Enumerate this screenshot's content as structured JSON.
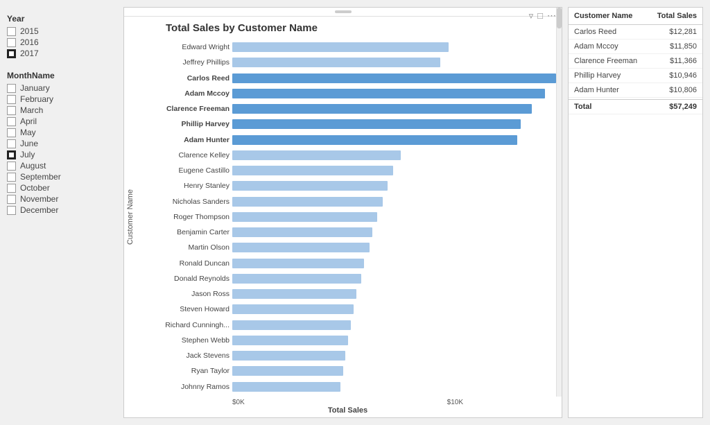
{
  "sidebar": {
    "year_label": "Year",
    "years": [
      {
        "label": "2015",
        "checked": false
      },
      {
        "label": "2016",
        "checked": false
      },
      {
        "label": "2017",
        "checked": true
      }
    ],
    "month_label": "MonthName",
    "months": [
      {
        "label": "January",
        "checked": false
      },
      {
        "label": "February",
        "checked": false
      },
      {
        "label": "March",
        "checked": false
      },
      {
        "label": "April",
        "checked": false
      },
      {
        "label": "May",
        "checked": false
      },
      {
        "label": "June",
        "checked": false
      },
      {
        "label": "July",
        "checked": true
      },
      {
        "label": "August",
        "checked": false
      },
      {
        "label": "September",
        "checked": false
      },
      {
        "label": "October",
        "checked": false
      },
      {
        "label": "November",
        "checked": false
      },
      {
        "label": "December",
        "checked": false
      }
    ]
  },
  "chart": {
    "title": "Total Sales by Customer Name",
    "y_axis_label": "Customer Name",
    "x_axis_label": "Total Sales",
    "x_ticks": [
      "$0K",
      "$10K"
    ],
    "max_value": 12281,
    "bars": [
      {
        "name": "Edward Wright",
        "value": 8200,
        "bold": false,
        "highlight": false
      },
      {
        "name": "Jeffrey Phillips",
        "value": 7900,
        "bold": false,
        "highlight": false
      },
      {
        "name": "Carlos Reed",
        "value": 12281,
        "bold": true,
        "highlight": true
      },
      {
        "name": "Adam Mccoy",
        "value": 11850,
        "bold": true,
        "highlight": true
      },
      {
        "name": "Clarence Freeman",
        "value": 11366,
        "bold": true,
        "highlight": true
      },
      {
        "name": "Phillip Harvey",
        "value": 10946,
        "bold": true,
        "highlight": true
      },
      {
        "name": "Adam Hunter",
        "value": 10806,
        "bold": true,
        "highlight": true
      },
      {
        "name": "Clarence Kelley",
        "value": 6400,
        "bold": false,
        "highlight": false
      },
      {
        "name": "Eugene Castillo",
        "value": 6100,
        "bold": false,
        "highlight": false
      },
      {
        "name": "Henry Stanley",
        "value": 5900,
        "bold": false,
        "highlight": false
      },
      {
        "name": "Nicholas Sanders",
        "value": 5700,
        "bold": false,
        "highlight": false
      },
      {
        "name": "Roger Thompson",
        "value": 5500,
        "bold": false,
        "highlight": false
      },
      {
        "name": "Benjamin Carter",
        "value": 5300,
        "bold": false,
        "highlight": false
      },
      {
        "name": "Martin Olson",
        "value": 5200,
        "bold": false,
        "highlight": false
      },
      {
        "name": "Ronald Duncan",
        "value": 5000,
        "bold": false,
        "highlight": false
      },
      {
        "name": "Donald Reynolds",
        "value": 4900,
        "bold": false,
        "highlight": false
      },
      {
        "name": "Jason Ross",
        "value": 4700,
        "bold": false,
        "highlight": false
      },
      {
        "name": "Steven Howard",
        "value": 4600,
        "bold": false,
        "highlight": false
      },
      {
        "name": "Richard Cunningh...",
        "value": 4500,
        "bold": false,
        "highlight": false
      },
      {
        "name": "Stephen Webb",
        "value": 4400,
        "bold": false,
        "highlight": false
      },
      {
        "name": "Jack Stevens",
        "value": 4300,
        "bold": false,
        "highlight": false
      },
      {
        "name": "Ryan Taylor",
        "value": 4200,
        "bold": false,
        "highlight": false
      },
      {
        "name": "Johnny Ramos",
        "value": 4100,
        "bold": false,
        "highlight": false
      }
    ]
  },
  "table": {
    "col_name": "Customer Name",
    "col_sales": "Total Sales",
    "rows": [
      {
        "name": "Carlos Reed",
        "sales": "$12,281"
      },
      {
        "name": "Adam Mccoy",
        "sales": "$11,850"
      },
      {
        "name": "Clarence Freeman",
        "sales": "$11,366"
      },
      {
        "name": "Phillip Harvey",
        "sales": "$10,946"
      },
      {
        "name": "Adam Hunter",
        "sales": "$10,806"
      }
    ],
    "total_label": "Total",
    "total_sales": "$57,249"
  }
}
